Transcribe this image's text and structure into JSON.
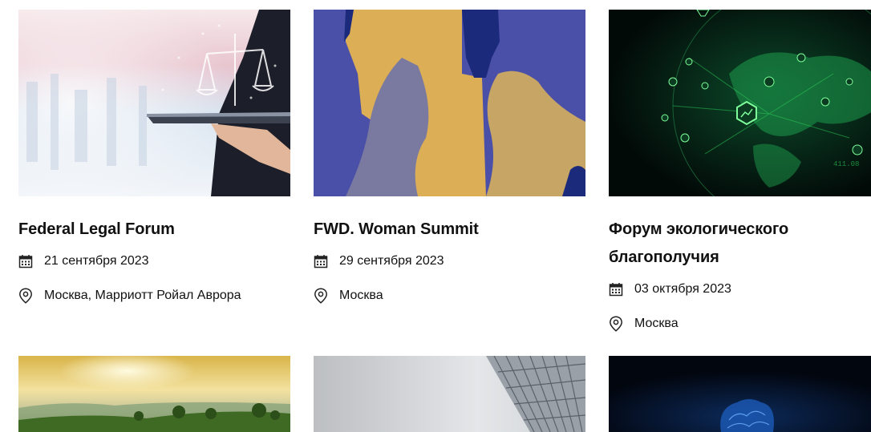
{
  "events": [
    {
      "title": "Federal Legal Forum",
      "date": "21 сентября 2023",
      "location": "Москва, Марриотт Ройал Аврора",
      "image_icon": "legal-scales-image"
    },
    {
      "title": "FWD. Woman Summit",
      "date": "29 сентября 2023",
      "location": "Москва",
      "image_icon": "women-silhouettes-image"
    },
    {
      "title": "Форум экологического благополучия",
      "date": "03 октября 2023",
      "location": "Москва",
      "image_icon": "digital-globe-image"
    }
  ],
  "next_row": [
    {
      "image_icon": "landscape-sunrise-image"
    },
    {
      "image_icon": "skyscraper-image"
    },
    {
      "image_icon": "digital-brain-image"
    }
  ],
  "colors": {
    "text": "#111111",
    "icon": "#222222",
    "summit_blue": "#4a4fa8",
    "summit_gold": "#dcae55",
    "globe_green": "#2fd35a"
  }
}
